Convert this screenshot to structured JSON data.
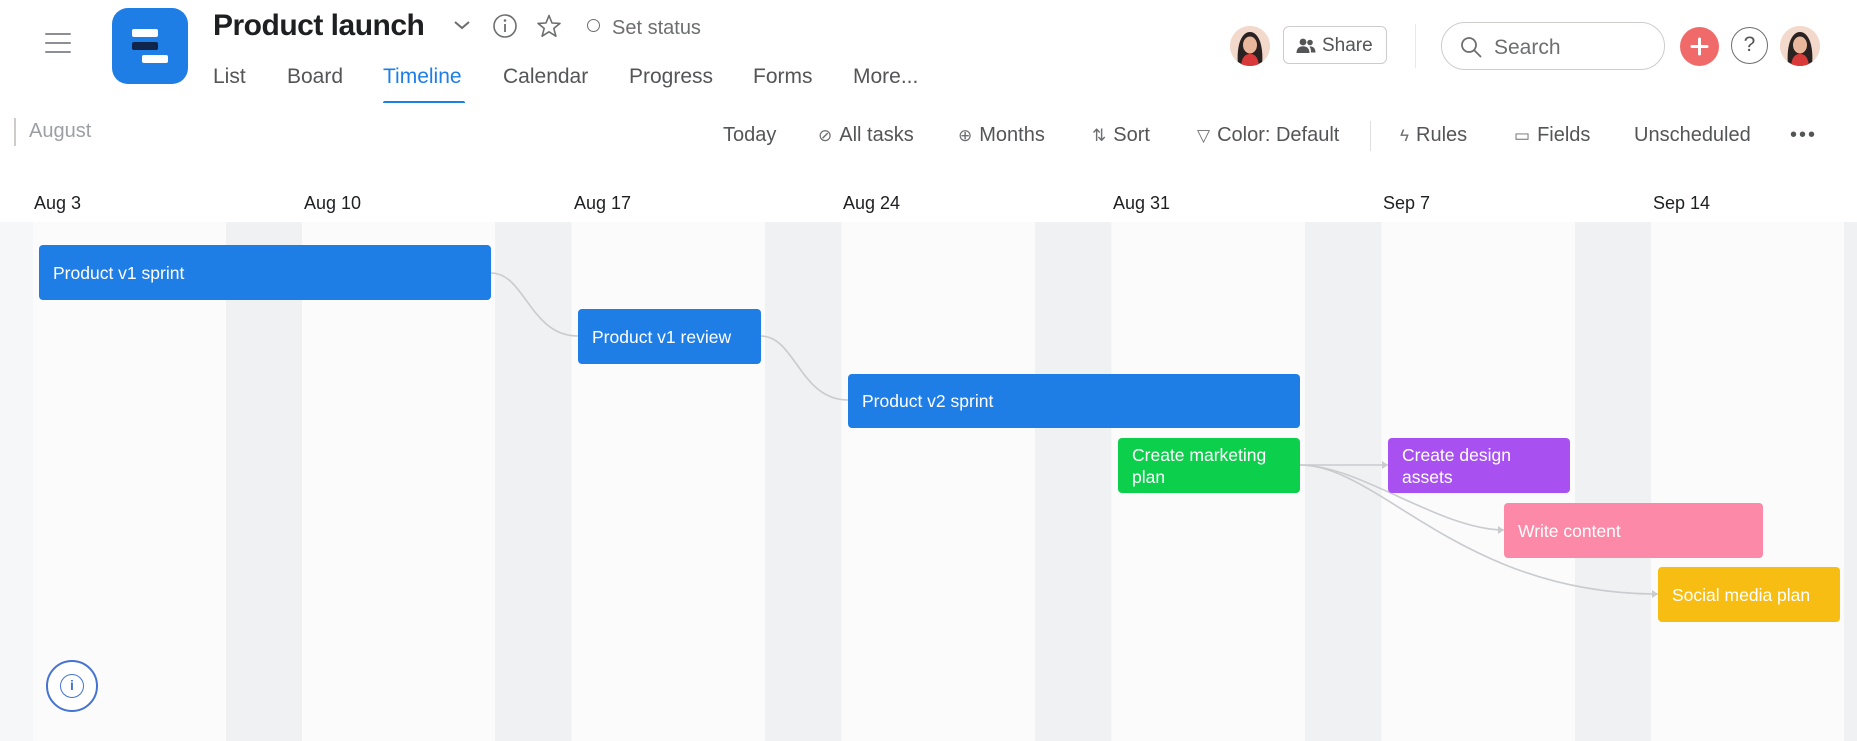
{
  "project": {
    "title": "Product launch",
    "set_status": "Set status",
    "brand_color": "#1f7ee6"
  },
  "nav": {
    "tabs": [
      {
        "label": "List"
      },
      {
        "label": "Board"
      },
      {
        "label": "Timeline",
        "active": true
      },
      {
        "label": "Calendar"
      },
      {
        "label": "Progress"
      },
      {
        "label": "Forms"
      },
      {
        "label": "More..."
      }
    ]
  },
  "header_actions": {
    "share_label": "Share",
    "search_placeholder": "Search",
    "help_label": "?"
  },
  "toolbar": {
    "month": "August",
    "today": "Today",
    "all_tasks": "All tasks",
    "zoom": "Months",
    "sort": "Sort",
    "color": "Color: Default",
    "rules": "Rules",
    "fields": "Fields",
    "unscheduled": "Unscheduled",
    "more": "•••"
  },
  "timeline": {
    "week_labels": [
      "Aug 3",
      "Aug 10",
      "Aug 17",
      "Aug 24",
      "Aug 31",
      "Sep 7",
      "Sep 14"
    ],
    "tasks": [
      {
        "name": "Product v1 sprint",
        "color": "#1f7ee6"
      },
      {
        "name": "Product v1 review",
        "color": "#1f7ee6"
      },
      {
        "name": "Product v2 sprint",
        "color": "#1f7ee6"
      },
      {
        "name": "Create marketing plan",
        "color": "#0ccf4c"
      },
      {
        "name": "Create design assets",
        "color": "#a951f0"
      },
      {
        "name": "Write content",
        "color": "#fc89a8"
      },
      {
        "name": "Social media plan",
        "color": "#f7bd12"
      }
    ]
  },
  "icons": {
    "menu": "hamburger-icon",
    "logo": "project-logo-icon",
    "dropdown": "chevron-down-icon",
    "info": "info-icon",
    "favorite": "star-icon",
    "status": "status-ring-icon",
    "share": "people-icon",
    "search": "search-icon",
    "add": "plus-icon",
    "help": "help-icon"
  }
}
